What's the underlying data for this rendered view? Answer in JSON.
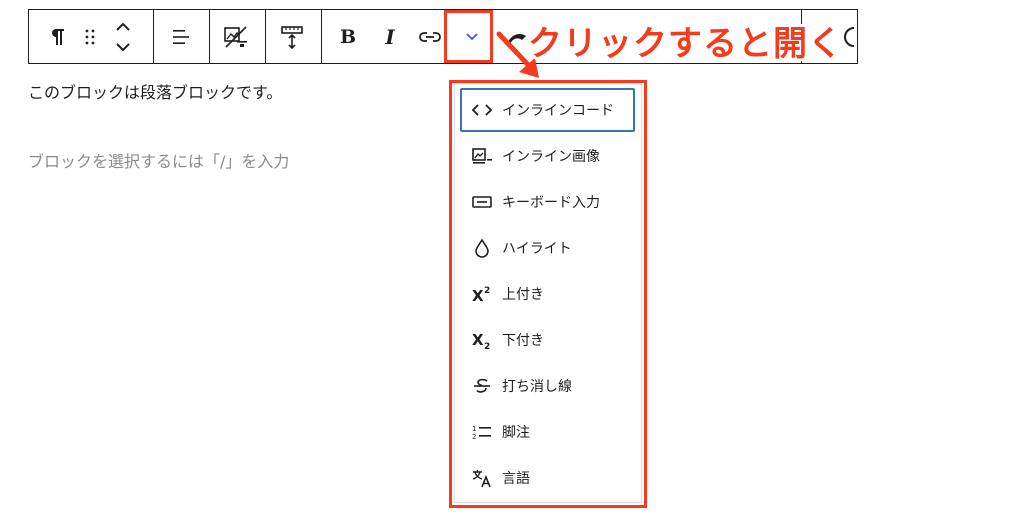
{
  "paragraph": {
    "text": "このブロックは段落ブロックです。"
  },
  "placeholder": {
    "text": "ブロックを選択するには「/」を入力"
  },
  "annotation": {
    "label": "クリックすると開く",
    "color": "#f53b1e"
  },
  "toolbar": {
    "bold_label": "B",
    "italic_label": "I",
    "icons": [
      "pilcrow-icon",
      "drag-handle-icon",
      "move-up-down-icon",
      "align-icon",
      "media-text-icon",
      "ruler-icon",
      "bold",
      "italic",
      "link-icon",
      "chevron-down-icon",
      "highlight-icon",
      "text-options-icon"
    ]
  },
  "menu": {
    "items": [
      {
        "label": "インラインコード",
        "icon": "code-icon"
      },
      {
        "label": "インライン画像",
        "icon": "inline-image-icon"
      },
      {
        "label": "キーボード入力",
        "icon": "keyboard-icon"
      },
      {
        "label": "ハイライト",
        "icon": "droplet-icon"
      },
      {
        "label": "上付き",
        "icon": "superscript-icon"
      },
      {
        "label": "下付き",
        "icon": "subscript-icon"
      },
      {
        "label": "打ち消し線",
        "icon": "strikethrough-icon"
      },
      {
        "label": "脚注",
        "icon": "footnote-icon"
      },
      {
        "label": "言語",
        "icon": "language-icon"
      }
    ]
  },
  "colors": {
    "accent_focus": "#3873b3",
    "annotation_red": "#f53b1e",
    "chevron_blue": "#3858e9"
  }
}
